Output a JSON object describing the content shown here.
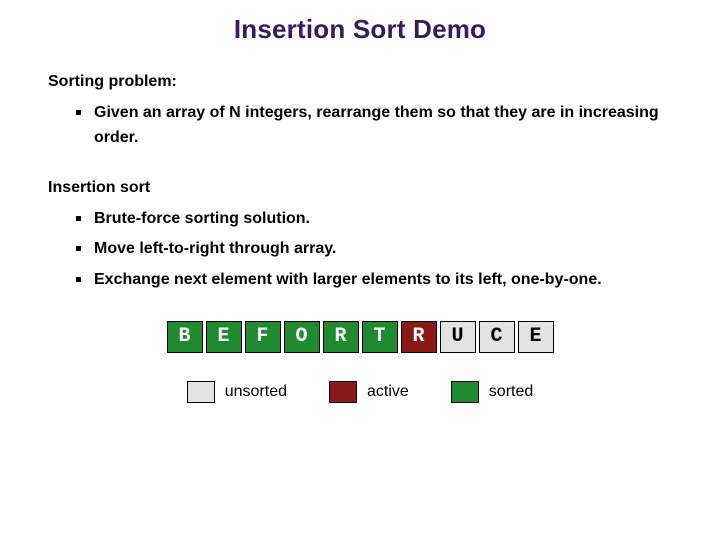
{
  "title": "Insertion Sort Demo",
  "sections": [
    {
      "heading": "Sorting problem:",
      "bullets": [
        "Given an array of N integers, rearrange them so that they are in increasing order."
      ]
    },
    {
      "heading": "Insertion sort",
      "bullets": [
        "Brute-force sorting solution.",
        "Move left-to-right through array.",
        "Exchange next element with larger elements to its left, one-by-one."
      ]
    }
  ],
  "array": [
    {
      "letter": "B",
      "state": "sorted"
    },
    {
      "letter": "E",
      "state": "sorted"
    },
    {
      "letter": "F",
      "state": "sorted"
    },
    {
      "letter": "O",
      "state": "sorted"
    },
    {
      "letter": "R",
      "state": "sorted"
    },
    {
      "letter": "T",
      "state": "sorted"
    },
    {
      "letter": "R",
      "state": "active"
    },
    {
      "letter": "U",
      "state": "unsorted"
    },
    {
      "letter": "C",
      "state": "unsorted"
    },
    {
      "letter": "E",
      "state": "unsorted"
    }
  ],
  "legend": [
    {
      "state": "unsorted",
      "label": "unsorted"
    },
    {
      "state": "active",
      "label": "active"
    },
    {
      "state": "sorted",
      "label": "sorted"
    }
  ],
  "colors": {
    "title": "#3a1a5c",
    "sorted": "#1f8a2f",
    "active": "#8a1a1a",
    "unsorted": "#e3e3e3"
  }
}
